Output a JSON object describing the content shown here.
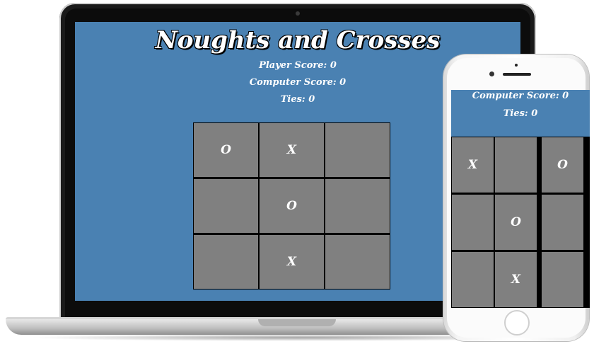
{
  "laptop": {
    "title": "Noughts and Crosses",
    "player_score": "Player Score: 0",
    "computer_score": "Computer Score: 0",
    "ties": "Ties: 0",
    "board": [
      "O",
      "X",
      "",
      "",
      "O",
      "",
      "",
      "X",
      ""
    ]
  },
  "phone": {
    "computer_score": "Computer Score: 0",
    "ties": "Ties: 0",
    "board": [
      "X",
      "",
      "O",
      "",
      "O",
      "",
      "",
      "X",
      ""
    ]
  },
  "colors": {
    "screen_bg": "#4a81b2",
    "cell_bg": "#808080",
    "grid_lines": "#000000",
    "text": "#ffffff"
  }
}
